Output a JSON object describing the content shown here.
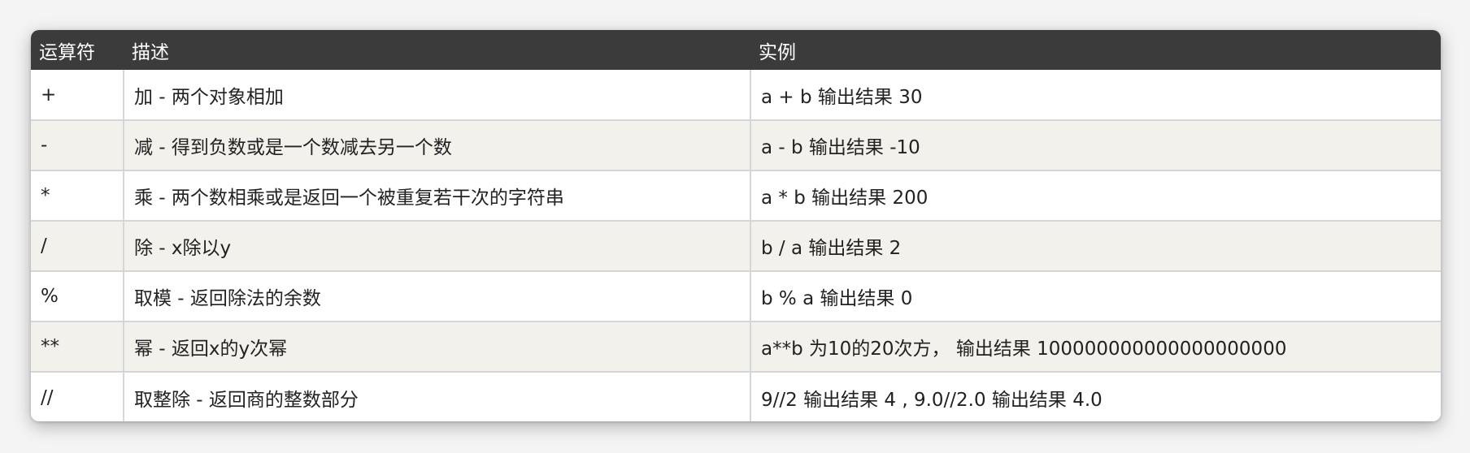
{
  "table": {
    "headers": [
      "运算符",
      "描述",
      "实例"
    ],
    "rows": [
      {
        "op": "+",
        "desc": "加 - 两个对象相加",
        "example": "a + b 输出结果 30"
      },
      {
        "op": "-",
        "desc": "减 - 得到负数或是一个数减去另一个数",
        "example": "a - b 输出结果 -10"
      },
      {
        "op": "*",
        "desc": "乘 - 两个数相乘或是返回一个被重复若干次的字符串",
        "example": "a * b 输出结果 200"
      },
      {
        "op": "/",
        "desc": "除 - x除以y",
        "example": "b / a 输出结果 2"
      },
      {
        "op": "%",
        "desc": "取模 - 返回除法的余数",
        "example": "b % a 输出结果 0"
      },
      {
        "op": "**",
        "desc": "幂 - 返回x的y次幂",
        "example": "a**b 为10的20次方， 输出结果 100000000000000000000"
      },
      {
        "op": "//",
        "desc": "取整除 - 返回商的整数部分",
        "example": "9//2 输出结果 4 , 9.0//2.0 输出结果 4.0"
      }
    ]
  },
  "colors": {
    "header_bg": "#3b3b3b",
    "header_text": "#ffffff",
    "row_odd": "#ffffff",
    "row_even": "#f2f1ec",
    "border": "#d6d6d6"
  }
}
